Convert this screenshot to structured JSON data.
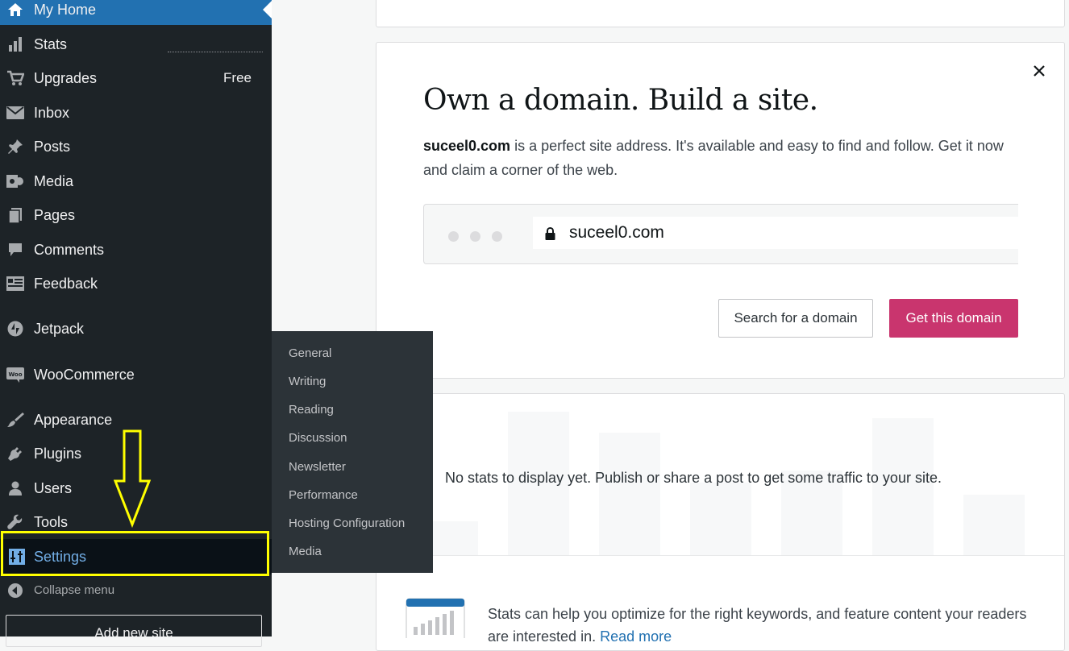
{
  "sidebar": {
    "items": [
      {
        "label": "My Home",
        "icon": "home-icon"
      },
      {
        "label": "Stats",
        "icon": "stats-icon"
      },
      {
        "label": "Upgrades",
        "icon": "cart-icon",
        "badge": "Free"
      },
      {
        "label": "Inbox",
        "icon": "mail-icon"
      },
      {
        "label": "Posts",
        "icon": "pin-icon"
      },
      {
        "label": "Media",
        "icon": "media-icon"
      },
      {
        "label": "Pages",
        "icon": "pages-icon"
      },
      {
        "label": "Comments",
        "icon": "comment-icon"
      },
      {
        "label": "Feedback",
        "icon": "feedback-icon"
      },
      {
        "label": "Jetpack",
        "icon": "jetpack-icon"
      },
      {
        "label": "WooCommerce",
        "icon": "woo-icon"
      },
      {
        "label": "Appearance",
        "icon": "brush-icon"
      },
      {
        "label": "Plugins",
        "icon": "plug-icon"
      },
      {
        "label": "Users",
        "icon": "user-icon"
      },
      {
        "label": "Tools",
        "icon": "wrench-icon"
      },
      {
        "label": "Settings",
        "icon": "settings-icon"
      }
    ],
    "collapse_label": "Collapse menu",
    "add_site_label": "Add new site"
  },
  "settings_flyout": {
    "items": [
      "General",
      "Writing",
      "Reading",
      "Discussion",
      "Newsletter",
      "Performance",
      "Hosting Configuration",
      "Media"
    ]
  },
  "domain_card": {
    "headline": "Own a domain. Build a site.",
    "domain": "suceel0.com",
    "description_rest": " is a perfect site address. It's available and easy to find and follow. Get it now and claim a corner of the web.",
    "url_text": "suceel0.com",
    "search_button": "Search for a domain",
    "get_button": "Get this domain"
  },
  "stats_card": {
    "empty_message": "No stats to display yet. Publish or share a post to get some traffic to your site.",
    "tip_text": "Stats can help you optimize for the right keywords, and feature content your readers are interested in.",
    "read_more": "Read more"
  },
  "colors": {
    "sidebar_bg": "#1d2327",
    "active_bg": "#2271b1",
    "flyout_bg": "#2c3338",
    "highlight": "#ffff00",
    "primary_button": "#c9356e",
    "settings_link": "#72aee6"
  }
}
